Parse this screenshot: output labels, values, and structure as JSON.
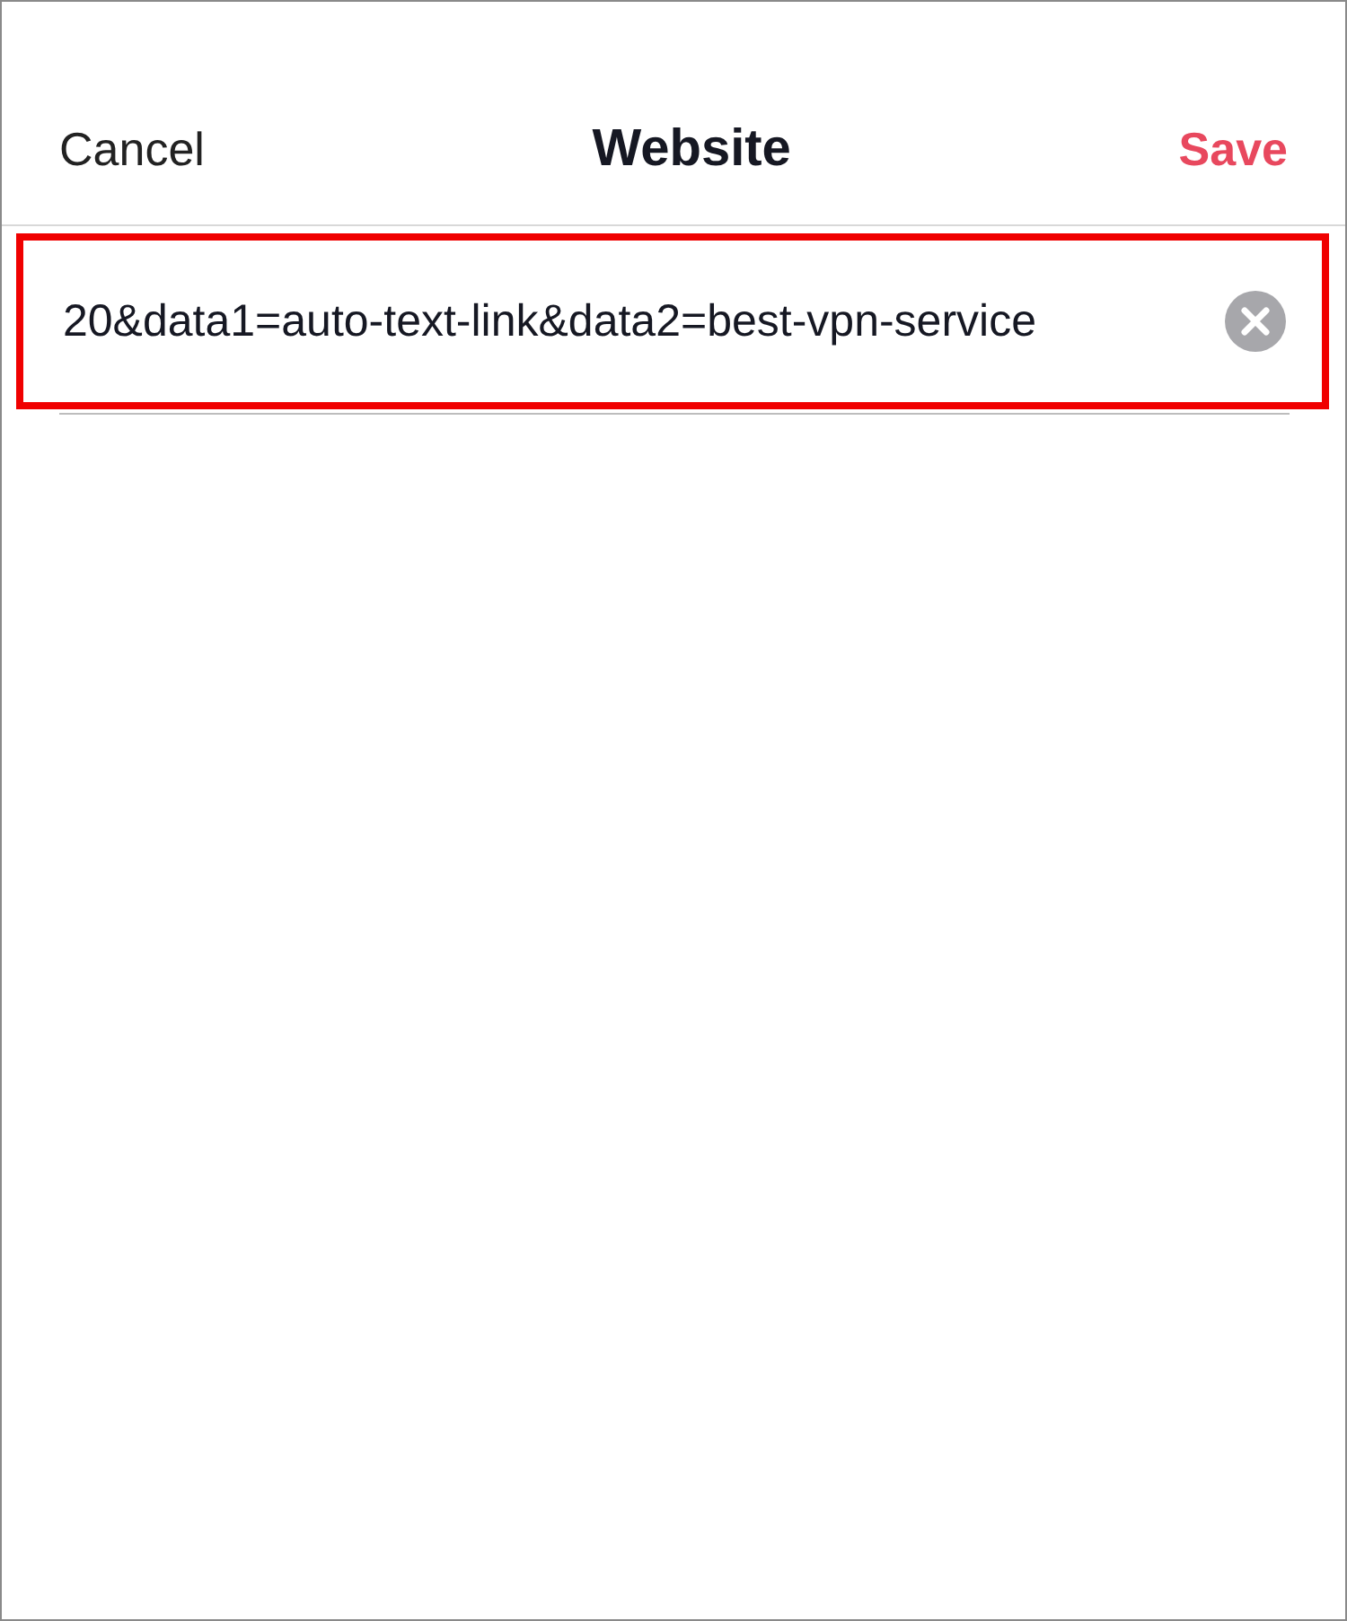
{
  "header": {
    "cancel": "Cancel",
    "title": "Website",
    "save": "Save"
  },
  "url_field": {
    "value": "20&data1=auto-text-link&data2=best-vpn-service",
    "highlighted": true
  }
}
